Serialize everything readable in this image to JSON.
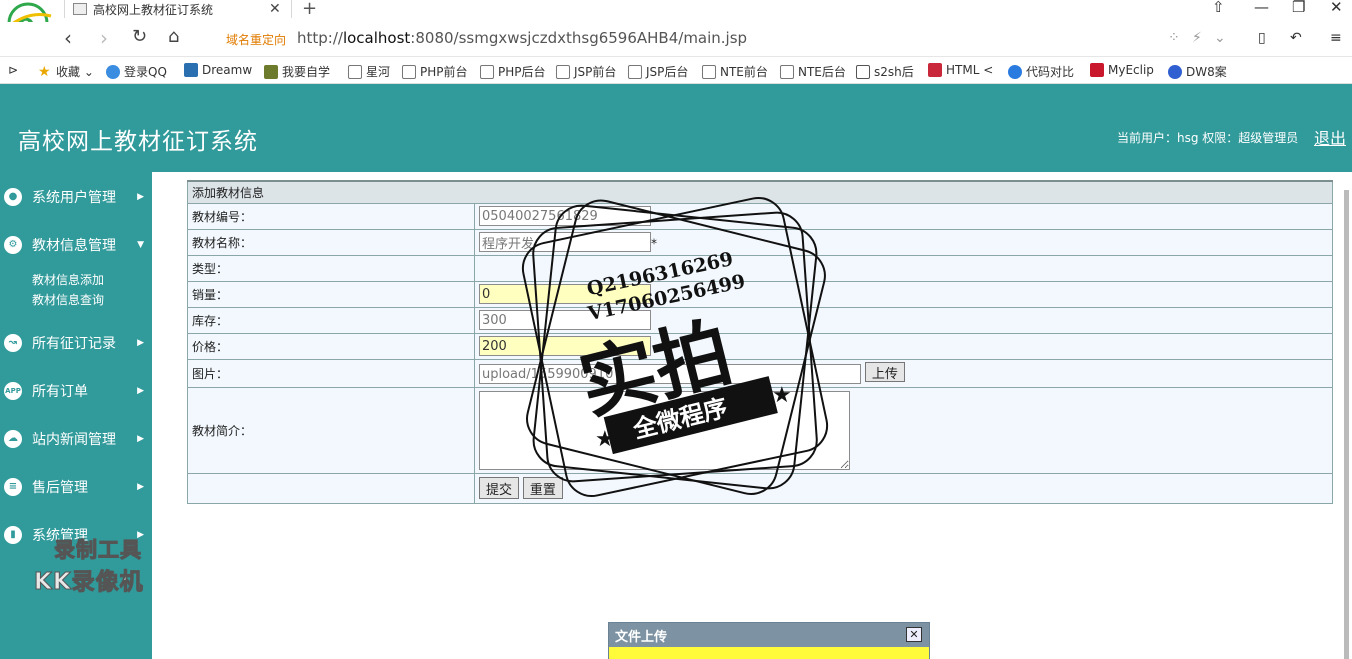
{
  "browser": {
    "tab_title": "高校网上教材征订系统",
    "redirect_label": "域名重定向",
    "url_prefix": "http://",
    "url_host": "localhost",
    "url_rest": ":8080/ssmgxwsjczdxthsg6596AHB4/main.jsp",
    "bookmarks": [
      "收藏",
      "登录QQ",
      "Dreamw",
      "我要自学",
      "星河",
      "PHP前台",
      "PHP后台",
      "JSP前台",
      "JSP后台",
      "NTE前台",
      "NTE后台",
      "s2sh后",
      "HTML <",
      "代码对比",
      "MyEclip",
      "DW8案"
    ]
  },
  "header": {
    "title": "高校网上教材征订系统",
    "user_label": "当前用户：hsg 权限：超级管理员",
    "logout": "退出"
  },
  "sidebar": {
    "items": [
      {
        "label": "系统用户管理",
        "icon": "user-icon"
      },
      {
        "label": "教材信息管理",
        "icon": "gear-user-icon"
      },
      {
        "label": "所有征订记录",
        "icon": "route-icon"
      },
      {
        "label": "所有订单",
        "icon": "app-icon"
      },
      {
        "label": "站内新闻管理",
        "icon": "cloud-icon"
      },
      {
        "label": "售后管理",
        "icon": "stack-icon"
      },
      {
        "label": "系统管理",
        "icon": "chart-icon"
      }
    ],
    "sub_items": [
      "教材信息添加",
      "教材信息查询"
    ]
  },
  "form": {
    "section_title": "添加教材信息",
    "fields": {
      "code_label": "教材编号：",
      "code_value": "05040027561829",
      "name_label": "教材名称：",
      "name_value": "程序开发",
      "required_mark": "*",
      "type_label": "类型：",
      "sales_label": "销量：",
      "sales_value": "0",
      "stock_label": "库存：",
      "stock_value": "300",
      "price_label": "价格：",
      "price_value": "200",
      "image_label": "图片：",
      "image_value": "upload/1559900910",
      "upload_button": "上传",
      "intro_label": "教材简介："
    },
    "submit": "提交",
    "reset": "重置"
  },
  "stamp": {
    "line1": "Q2196316269",
    "line2": "V17060256499",
    "big": "实拍",
    "banner": "全微程序"
  },
  "watermark": {
    "line1": "录制工具",
    "line2": "KK录像机"
  },
  "dialog": {
    "title": "文件上传",
    "close": "✕"
  }
}
